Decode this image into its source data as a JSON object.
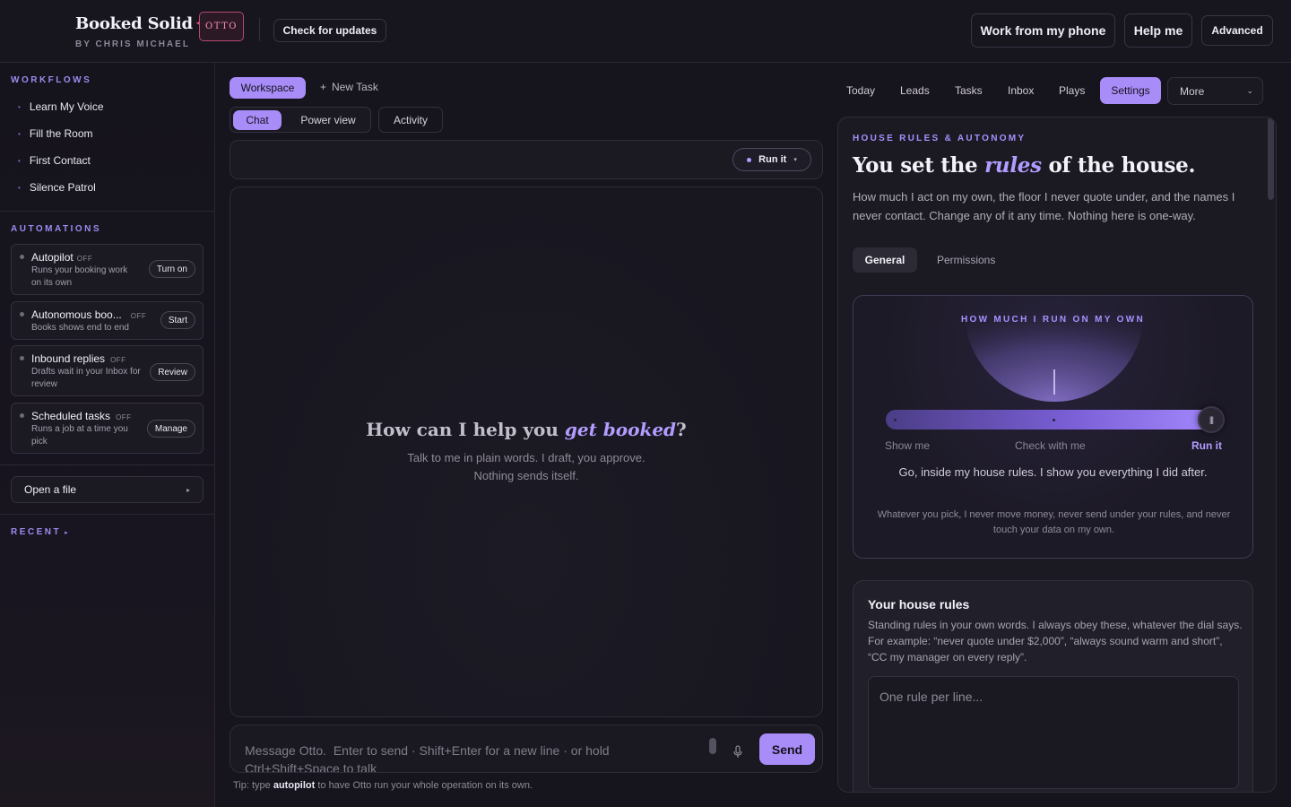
{
  "header": {
    "brand": "Booked Solid",
    "byline": "BY CHRIS MICHAEL",
    "badge": "OTTO",
    "check_updates": "Check for updates",
    "work_phone": "Work from my phone",
    "help": "Help me",
    "advanced": "Advanced"
  },
  "sidebar": {
    "workflows_title": "WORKFLOWS",
    "workflows": [
      "Learn My Voice",
      "Fill the Room",
      "First Contact",
      "Silence Patrol"
    ],
    "automations_title": "AUTOMATIONS",
    "automations": [
      {
        "title": "Autopilot",
        "status": "OFF",
        "desc": "Runs your booking work on its own",
        "action": "Turn on"
      },
      {
        "title": "Autonomous boo...",
        "status": "OFF",
        "desc": "Books shows end to end",
        "action": "Start"
      },
      {
        "title": "Inbound replies",
        "status": "OFF",
        "desc": "Drafts wait in your Inbox for review",
        "action": "Review"
      },
      {
        "title": "Scheduled tasks",
        "status": "OFF",
        "desc": "Runs a job at a time you pick",
        "action": "Manage"
      }
    ],
    "open_file": "Open a file",
    "recent_title": "RECENT"
  },
  "center": {
    "workspace_tab": "Workspace",
    "new_task": "New Task",
    "view_tabs": [
      "Chat",
      "Power view"
    ],
    "activity": "Activity",
    "run_it": "Run it",
    "empty_title_pre": "How can I help you ",
    "empty_title_em": "get booked",
    "empty_title_post": "?",
    "empty_sub_1": "Talk to me in plain words. I draft, you approve.",
    "empty_sub_2": "Nothing sends itself.",
    "composer_placeholder": "Message Otto.  Enter to send · Shift+Enter for a new line · or hold Ctrl+Shift+Space to talk",
    "send": "Send",
    "tip_pre": "Tip: type ",
    "tip_keyword": "autopilot",
    "tip_post": " to have Otto run your whole operation on its own."
  },
  "nav": {
    "links": [
      "Today",
      "Leads",
      "Tasks",
      "Inbox",
      "Plays"
    ],
    "settings": "Settings",
    "more": "More"
  },
  "settings": {
    "eyebrow": "HOUSE RULES & AUTONOMY",
    "title_pre": "You set the ",
    "title_em": "rules",
    "title_post": " of the house.",
    "desc": "How much I act on my own, the floor I never quote under, and the names I never contact. Change any of it any time. Nothing here is one-way.",
    "tabs": {
      "general": "General",
      "permissions": "Permissions"
    },
    "dial": {
      "eyebrow": "HOW MUCH I RUN ON MY OWN",
      "labels": [
        "Show me",
        "Check with me",
        "Run it"
      ],
      "selected_level": 2,
      "status": "Go, inside my house rules. I show you everything I did after.",
      "footnote": "Whatever you pick, I never move money, never send under your rules, and never touch your data on my own."
    },
    "rules": {
      "title": "Your house rules",
      "desc": "Standing rules in your own words. I always obey these, whatever the dial says. For example: “never quote under $2,000”, “always sound warm and short”, “CC my manager on every reply”.",
      "placeholder": "One rule per line..."
    }
  },
  "colors": {
    "accent": "#a88cf8",
    "brand_star": "#ff4f8a",
    "background": "#16141d"
  }
}
